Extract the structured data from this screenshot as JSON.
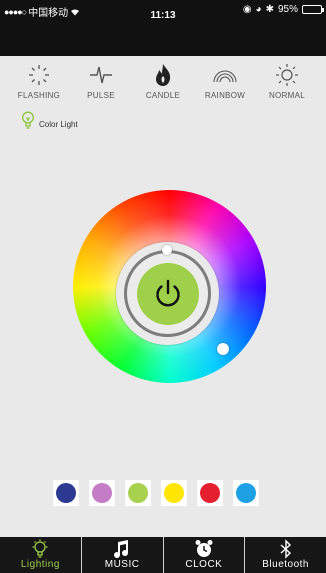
{
  "status_bar": {
    "carrier": "中国移动",
    "time": "11:13",
    "battery": "95%",
    "battery_level": 0.95
  },
  "modes": [
    {
      "label": "FLASHING",
      "icon": "flashing-icon"
    },
    {
      "label": "PULSE",
      "icon": "pulse-icon"
    },
    {
      "label": "CANDLE",
      "icon": "candle-icon"
    },
    {
      "label": "RAINBOW",
      "icon": "rainbow-icon"
    },
    {
      "label": "NORMAL",
      "icon": "normal-sun-icon"
    }
  ],
  "color_light": {
    "label": "Color Light",
    "icon": "bulb-icon"
  },
  "power": {
    "icon": "power-icon",
    "color": "#9ed04a"
  },
  "swatches": [
    {
      "name": "navy",
      "color": "#2b3990"
    },
    {
      "name": "orchid",
      "color": "#c47cc6"
    },
    {
      "name": "lime",
      "color": "#a8d24e"
    },
    {
      "name": "yellow",
      "color": "#ffe500"
    },
    {
      "name": "red",
      "color": "#e5202e"
    },
    {
      "name": "sky-blue",
      "color": "#1ea1e4"
    }
  ],
  "tabs": [
    {
      "label": "Lighting",
      "icon": "bulb-icon",
      "active": true
    },
    {
      "label": "MUSIC",
      "icon": "music-note-icon",
      "active": false
    },
    {
      "label": "CLOCK",
      "icon": "alarm-clock-icon",
      "active": false
    },
    {
      "label": "Bluetooth",
      "icon": "bluetooth-icon",
      "active": false
    }
  ],
  "colors": {
    "accent": "#9ed04a",
    "tabbar": "#161616",
    "status_bar": "#111111"
  }
}
